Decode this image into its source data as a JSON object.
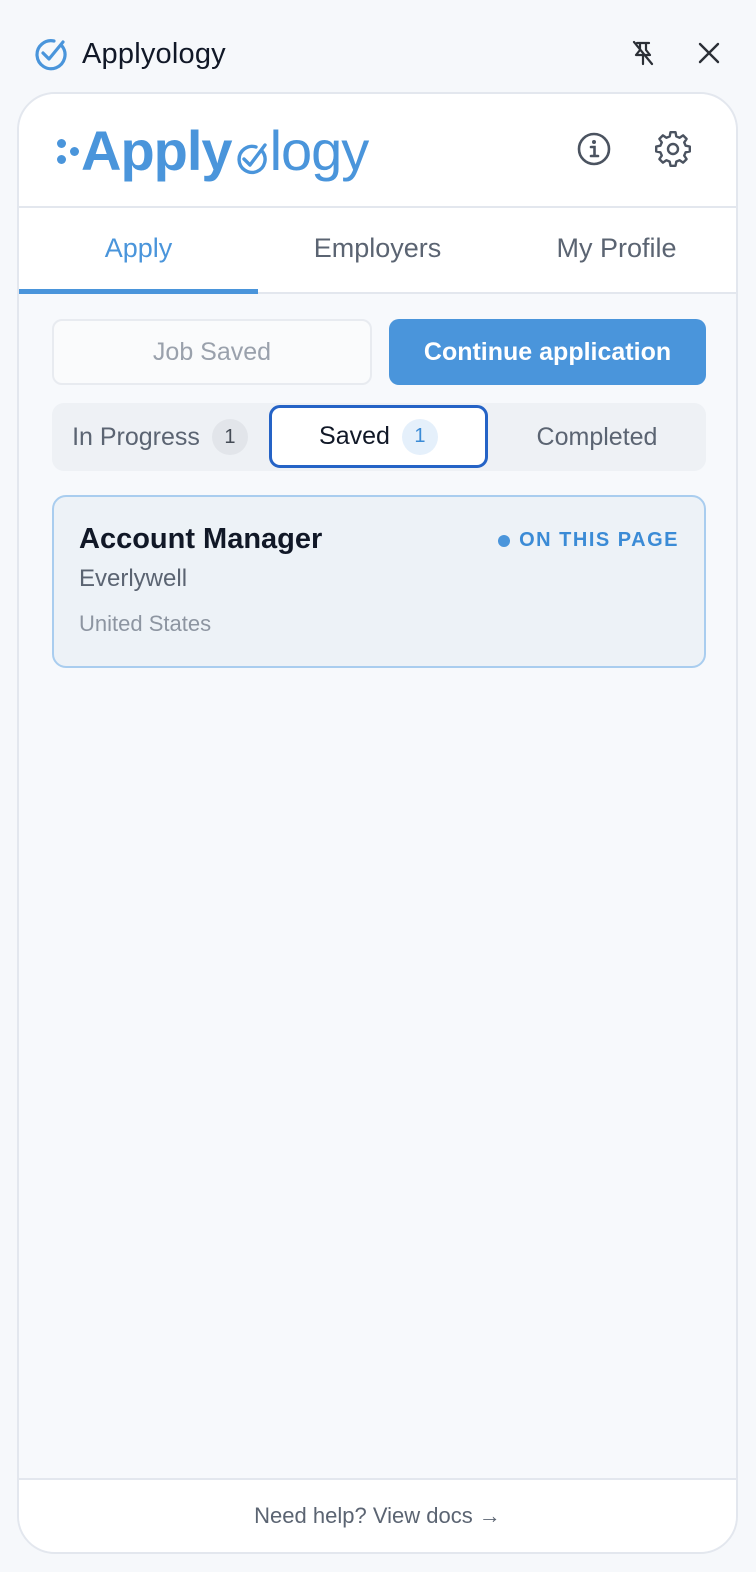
{
  "window": {
    "title": "Applyology",
    "pin_icon": "pin-off-icon",
    "close_icon": "close-icon",
    "app_icon": "check-circle-icon"
  },
  "header": {
    "logo": "Applyology",
    "info_icon": "info-icon",
    "settings_icon": "gear-icon"
  },
  "tabs": [
    {
      "label": "Apply",
      "active": true
    },
    {
      "label": "Employers",
      "active": false
    },
    {
      "label": "My Profile",
      "active": false
    }
  ],
  "actions": {
    "job_saved_label": "Job Saved",
    "continue_label": "Continue application"
  },
  "filters": [
    {
      "label": "In Progress",
      "count": "1",
      "selected": false
    },
    {
      "label": "Saved",
      "count": "1",
      "selected": true
    },
    {
      "label": "Completed",
      "count": "",
      "selected": false
    }
  ],
  "jobs": [
    {
      "title": "Account Manager",
      "company": "Everlywell",
      "location": "United States",
      "badge": "ON THIS PAGE"
    }
  ],
  "footer": {
    "help_text": "Need help? View docs →"
  },
  "colors": {
    "accent": "#4a95db",
    "selected_border": "#2563c6",
    "background": "#f6f8fb"
  }
}
